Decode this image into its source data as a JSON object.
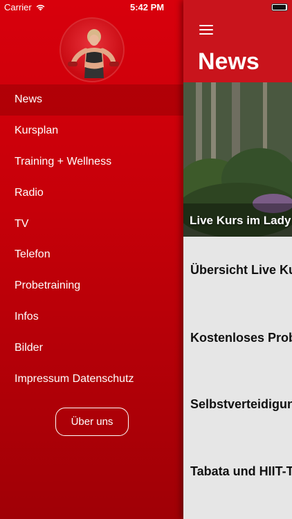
{
  "status_bar": {
    "carrier": "Carrier",
    "time": "5:42 PM"
  },
  "drawer": {
    "menu": [
      {
        "label": "News",
        "active": true
      },
      {
        "label": "Kursplan"
      },
      {
        "label": "Training + Wellness"
      },
      {
        "label": "Radio"
      },
      {
        "label": "TV"
      },
      {
        "label": "Telefon"
      },
      {
        "label": "Probetraining"
      },
      {
        "label": "Infos"
      },
      {
        "label": "Bilder"
      },
      {
        "label": "Impressum Datenschutz"
      }
    ],
    "about_label": "Über uns"
  },
  "main": {
    "title": "News",
    "hero_caption": "Live Kurs im Lady",
    "news_items": [
      "Übersicht Live Ku",
      "Kostenloses Prob",
      "Selbstverteidigun",
      "Tabata und HIIT-T"
    ]
  }
}
